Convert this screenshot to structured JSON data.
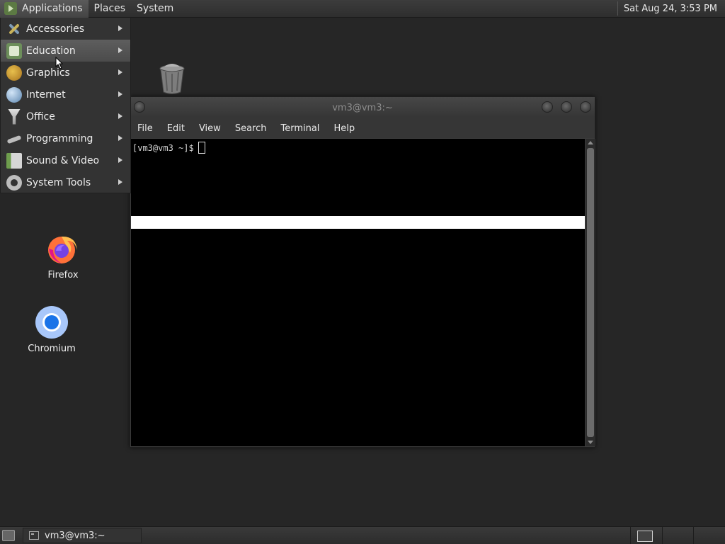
{
  "top_panel": {
    "menus": [
      "Applications",
      "Places",
      "System"
    ],
    "clock": "Sat Aug 24,  3:53 PM"
  },
  "app_menu": {
    "items": [
      {
        "label": "Accessories",
        "icon": "accessories-icon"
      },
      {
        "label": "Education",
        "icon": "education-icon"
      },
      {
        "label": "Graphics",
        "icon": "graphics-icon"
      },
      {
        "label": "Internet",
        "icon": "internet-icon"
      },
      {
        "label": "Office",
        "icon": "office-icon"
      },
      {
        "label": "Programming",
        "icon": "programming-icon"
      },
      {
        "label": "Sound & Video",
        "icon": "sound-video-icon"
      },
      {
        "label": "System Tools",
        "icon": "system-tools-icon"
      }
    ],
    "highlighted": "Education"
  },
  "desktop": {
    "icons": [
      {
        "label": "Firefox",
        "icon": "firefox-icon"
      },
      {
        "label": "Chromium",
        "icon": "chromium-icon"
      }
    ],
    "trash_icon": "trash-icon"
  },
  "terminal": {
    "title": "vm3@vm3:~",
    "menu": [
      "File",
      "Edit",
      "View",
      "Search",
      "Terminal",
      "Help"
    ],
    "prompt": "[vm3@vm3 ~]$"
  },
  "bottom_panel": {
    "task_label": "vm3@vm3:~"
  }
}
